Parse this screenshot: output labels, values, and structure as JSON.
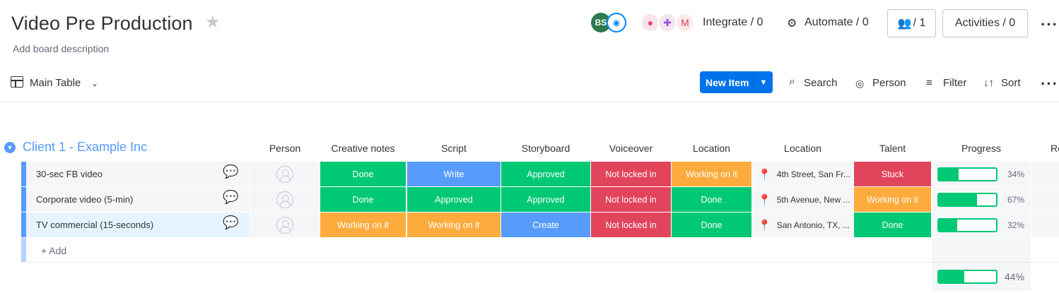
{
  "header": {
    "title": "Video Pre Production",
    "description": "Add board description",
    "avatar_initials": "BS",
    "integrate": "Integrate / 0",
    "automate": "Automate / 0",
    "members": "/ 1",
    "activities": "Activities / 0"
  },
  "toolbar": {
    "view": "Main Table",
    "new_item": "New Item",
    "search": "Search",
    "person": "Person",
    "filter": "Filter",
    "sort": "Sort"
  },
  "group": {
    "title": "Client 1 - Example Inc",
    "color": "#579bfc",
    "columns": [
      "Person",
      "Creative notes",
      "Script",
      "Storyboard",
      "Voiceover",
      "Location",
      "Location",
      "Talent",
      "Progress",
      "Re"
    ],
    "add_label": "+ Add",
    "summary_progress": 44,
    "summary_label": "44%"
  },
  "status_colors": {
    "Done": "#00c875",
    "Write": "#579bfc",
    "Approved": "#00c875",
    "Not locked in": "#e2445c",
    "Working on it": "#fdab3d",
    "Stuck": "#e2445c",
    "Create": "#579bfc"
  },
  "rows": [
    {
      "name": "30-sec FB video",
      "creative_notes": "Done",
      "script": "Write",
      "storyboard": "Approved",
      "voiceover": "Not locked in",
      "location_status": "Working on it",
      "location_text": "4th Street, San Fr...",
      "talent": "Stuck",
      "progress": 34,
      "progress_label": "34%"
    },
    {
      "name": "Corporate video (5-min)",
      "creative_notes": "Done",
      "script": "Approved",
      "storyboard": "Approved",
      "voiceover": "Not locked in",
      "location_status": "Done",
      "location_text": "5th Avenue, New ...",
      "talent": "Working on it",
      "progress": 67,
      "progress_label": "67%"
    },
    {
      "name": "TV commercial (15-seconds)",
      "creative_notes": "Working on it",
      "script": "Working on it",
      "storyboard": "Create",
      "voiceover": "Not locked in",
      "location_status": "Done",
      "location_text": "San Antonio, TX, ...",
      "talent": "Done",
      "progress": 32,
      "progress_label": "32%"
    }
  ]
}
